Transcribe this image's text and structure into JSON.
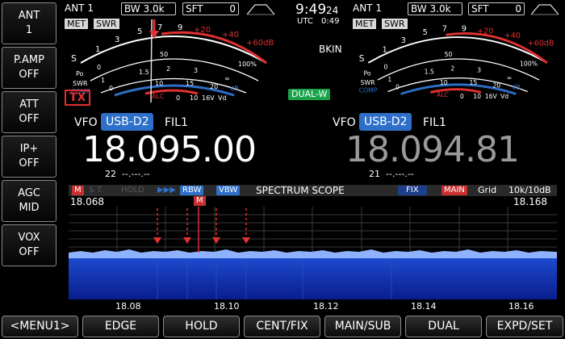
{
  "left_panel": [
    {
      "top": "ANT",
      "bottom": "1"
    },
    {
      "top": "P.AMP",
      "bottom": "OFF"
    },
    {
      "top": "ATT",
      "bottom": "OFF"
    },
    {
      "top": "IP+",
      "bottom": "OFF"
    },
    {
      "top": "AGC",
      "bottom": "MID"
    },
    {
      "top": "VOX",
      "bottom": "OFF"
    }
  ],
  "main": {
    "ant": "ANT 1",
    "bw_label": "BW",
    "bw_value": "3.0k",
    "sft_label": "SFT",
    "sft_value": "0",
    "meter_label1": "MET",
    "meter_label2": "SWR",
    "tx": "TX",
    "vfo": "VFO",
    "mode": "USB-D2",
    "fil": "FIL1",
    "frequency": "18.095.00",
    "sub_info": "22  --.---.--"
  },
  "sub": {
    "ant": "ANT 1",
    "bw_label": "BW",
    "bw_value": "3.0k",
    "sft_label": "SFT",
    "sft_value": "0",
    "meter_label1": "MET",
    "meter_label2": "SWR",
    "bkin": "BKIN",
    "dualw": "DUAL-W",
    "vfo": "VFO",
    "mode": "USB-D2",
    "fil": "FIL1",
    "frequency": "18.094.81",
    "sub_info": "21  --.---.--"
  },
  "clock": {
    "time": "9:49",
    "seconds": "24",
    "utc_label": "UTC",
    "utc_time": "0:49"
  },
  "meter_scale": {
    "s_labels": [
      "S",
      "1",
      "3",
      "5",
      "7",
      "9"
    ],
    "plus_labels": [
      "+20",
      "+40",
      "+60dB"
    ],
    "po_labels": [
      "Po",
      "0",
      "50",
      "100%"
    ],
    "swr_labels": [
      "SWR",
      "1",
      "1.5",
      "2",
      "3",
      "∞"
    ],
    "comp_labels": [
      "COMP",
      "0",
      "10",
      "15",
      "20",
      "dB"
    ],
    "alc_label": "ALC",
    "vd_labels": [
      "0",
      "10",
      "16V",
      "Vd"
    ]
  },
  "scope": {
    "header_tags": [
      "M",
      "S",
      "T",
      "HOLD"
    ],
    "rbw": "RBW",
    "vbw": "VBW",
    "title": "SPECTRUM SCOPE",
    "fix": "FIX",
    "main": "MAIN",
    "grid": "Grid",
    "span": "10k/10dB",
    "left_freq": "18.068",
    "right_freq": "18.168",
    "marker": "M",
    "x_labels": [
      "18.08",
      "18.10",
      "18.12",
      "18.14",
      "18.16"
    ]
  },
  "bottom_buttons": [
    "<MENU1>",
    "EDGE",
    "HOLD",
    "CENT/FIX",
    "MAIN/SUB",
    "DUAL",
    "EXPD/SET"
  ],
  "colors": {
    "accent_blue": "#2d6fc9",
    "tx_red": "#e03030",
    "dualw_green": "#1aa34a",
    "scope_blue": "#0a1e8c"
  }
}
